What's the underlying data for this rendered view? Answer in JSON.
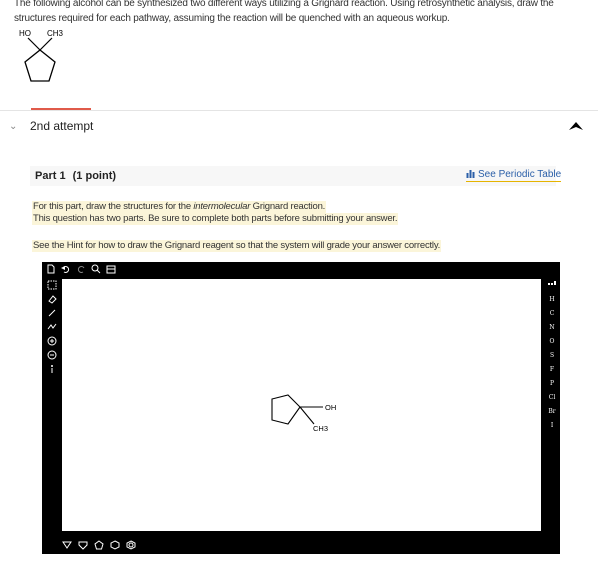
{
  "question": {
    "text": "The following alcohol can be synthesized two different ways utilizing a Grignard reaction. Using retrosynthetic analysis, draw the structures required for each pathway, assuming the reaction will be quenched with an aqueous workup.",
    "struct_labels": {
      "ho": "HO",
      "ch3": "CH3"
    }
  },
  "attempt": {
    "label": "2nd attempt",
    "chevron": "⌄"
  },
  "part": {
    "title": "Part 1",
    "points": "(1 point)",
    "periodic_link": "See Periodic Table"
  },
  "instructions": {
    "line1_pre": "For this part, draw the structures for the ",
    "line1_em": "intermolecular",
    "line1_post": " Grignard reaction.",
    "line2": "This question has two parts. Be sure to complete both parts before submitting your answer.",
    "hint": "See the Hint for how to draw the Grignard reagent so that the system will grade your answer correctly."
  },
  "editor": {
    "top_tools": [
      "new-icon",
      "undo-icon",
      "redo-icon",
      "zoom-icon",
      "template-icon"
    ],
    "left_tools": [
      "select-icon",
      "erase-icon",
      "bond-icon",
      "chain-icon",
      "charge-plus-icon",
      "charge-minus-icon",
      "more-icon"
    ],
    "elements": [
      "H",
      "C",
      "N",
      "O",
      "S",
      "F",
      "P",
      "Cl",
      "Br",
      "I"
    ],
    "bottom_shapes": [
      "triangle-icon",
      "square-icon",
      "pentagon-icon",
      "hexagon-icon",
      "benzene-icon"
    ],
    "molecule": {
      "oh": "OH",
      "ch3": "CH3"
    }
  }
}
